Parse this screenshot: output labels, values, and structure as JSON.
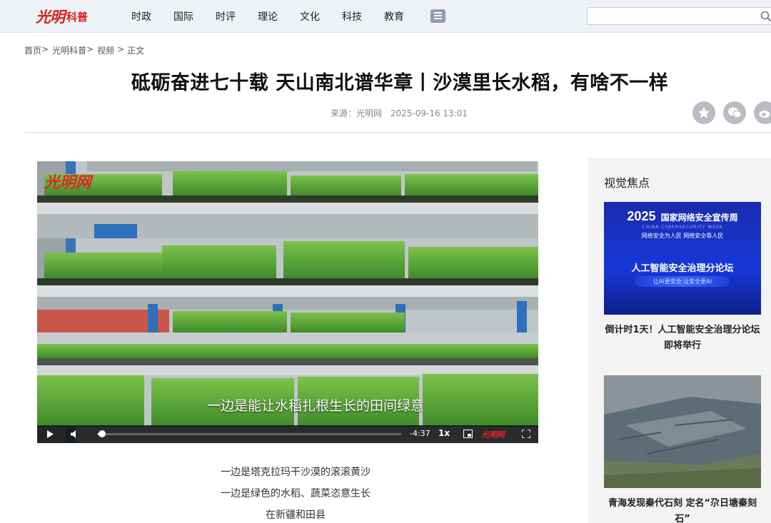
{
  "header": {
    "logo_glyph": "光明",
    "logo_sub": "科普",
    "nav": [
      "时政",
      "国际",
      "时评",
      "理论",
      "文化",
      "科技",
      "教育"
    ],
    "search_placeholder": ""
  },
  "breadcrumb": {
    "items": [
      "首页",
      "光明科普",
      "视频",
      "正文"
    ],
    "separator": ">"
  },
  "article": {
    "title": "砥砺奋进七十载 天山南北谱华章丨沙漠里长水稻，有啥不一样",
    "source": "来源：光明网",
    "datetime": "2025-09-16 13:01",
    "paragraphs": [
      "一边是塔克拉玛干沙漠的滚滚黄沙",
      "一边是绿色的水稻、蔬菜恣意生长",
      "在新疆和田县"
    ]
  },
  "video": {
    "watermark": "光明网",
    "subtitle": "一边是能让水稻扎根生长的田间绿意",
    "time_remaining": "-4:37",
    "speed": "1x",
    "progress": 0.01,
    "control_watermark": "光明网"
  },
  "sidebar": {
    "title": "视觉焦点",
    "cards": [
      {
        "caption": "倒计时1天！人工智能安全治理分论坛即将举行",
        "banner": {
          "year": "2025",
          "event": "国家网络安全宣传周",
          "event_en": "CHINA CYBERSECURITY WEEK",
          "slogan": "网络安全为人民 网络安全靠人民",
          "forum": "人工智能安全治理分论坛",
          "tagline": "让AI更安全 让安全更AI"
        }
      },
      {
        "caption": "青海发现秦代石刻 定名“尕日塘秦刻石”"
      }
    ]
  },
  "colors": {
    "brand_red": "#d8231e",
    "nav_bg": "#eef1f5",
    "sidebar_bg": "#f3f3f3",
    "banner_blue": "#1a2fb8"
  }
}
